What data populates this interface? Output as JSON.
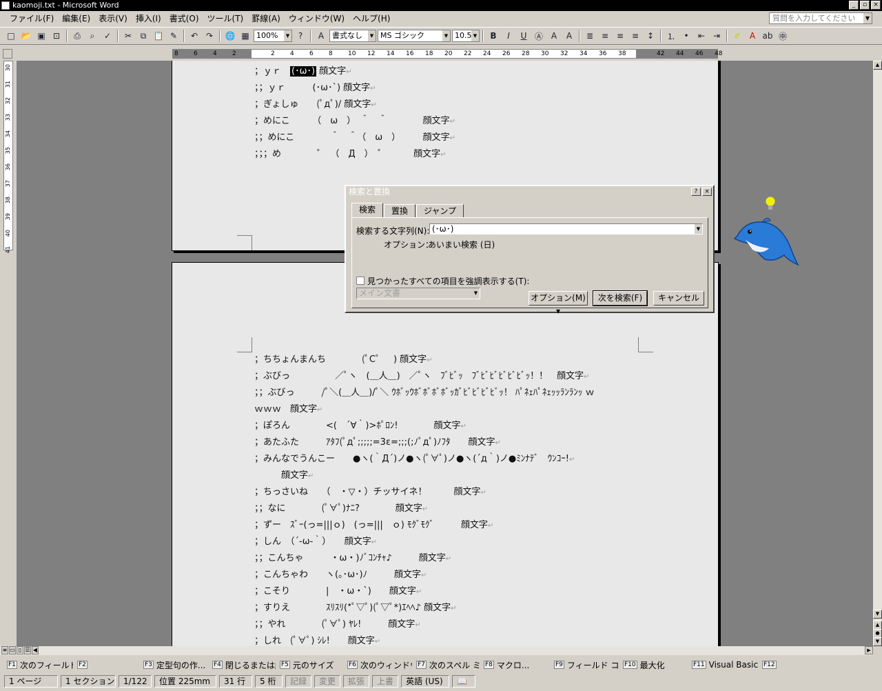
{
  "window": {
    "title": "kaomoji.txt - Microsoft Word"
  },
  "menu": [
    "ファイル(F)",
    "編集(E)",
    "表示(V)",
    "挿入(I)",
    "書式(O)",
    "ツール(T)",
    "罫線(A)",
    "ウィンドウ(W)",
    "ヘルプ(H)"
  ],
  "help_box": {
    "placeholder": "質問を入力してください"
  },
  "toolbar": {
    "zoom": "100%",
    "style": "書式なし",
    "font": "MS ゴシック",
    "size": "10.5"
  },
  "ruler": {
    "marks": [
      "8",
      "6",
      "4",
      "2",
      "2",
      "4",
      "6",
      "8",
      "10",
      "12",
      "14",
      "16",
      "18",
      "20",
      "22",
      "24",
      "26",
      "28",
      "30",
      "32",
      "34",
      "36",
      "38",
      "42",
      "44",
      "46",
      "48"
    ]
  },
  "vruler": {
    "marks": [
      "30",
      "31",
      "32",
      "33",
      "34",
      "35",
      "36",
      "37",
      "38",
      "39",
      "40",
      "41"
    ]
  },
  "page1_lines": [
    {
      "pre": "；ｙｒ　",
      "hl": "(･ω･)",
      "post": " 顔文字"
    },
    {
      "pre": "；；ｙｒ　　　(･ω･`) 顔文字",
      "hl": "",
      "post": ""
    },
    {
      "pre": "；ぎょしゅ　　(ﾟдﾟ)/ 顔文字",
      "hl": "",
      "post": ""
    },
    {
      "pre": "；めにこ　　　（　ω　）　＾　＾　　　　顔文字",
      "hl": "",
      "post": ""
    },
    {
      "pre": "；；めにこ　　　　＾　＾（　ω　）　　　顔文字",
      "hl": "",
      "post": ""
    },
    {
      "pre": "；；；め　　　　゜　（　Д　）　゜　　　顔文字",
      "hl": "",
      "post": ""
    }
  ],
  "page2_lines": [
    "；ちちょんまんち　　　　(ﾟC゜　) 顔文字",
    "；ぶびっ　　　　　／ﾟヽ　(＿人＿)　／ﾟヽ　ﾌﾞﾋﾞｯ　ﾌﾞﾋﾞﾋﾞﾋﾞﾋﾞﾋﾞｯ！！　顔文字",
    "；；ぶびっ　　　/ﾟ＼(＿人＿)/ﾟ＼ ｳﾎﾞｯｳﾎﾞﾎﾞﾎﾞﾎﾞｯｶﾞﾋﾞﾋﾞﾋﾞﾋﾞｯ！ ﾊﾟﾈｪﾊﾟﾈｪｯｯﾗﾝﾗﾝｯ ｗ",
    "ｗｗｗ　顔文字",
    "；ぽろん　　　　<(　´∀｀)>ﾎﾟﾛﾝ!　　　　顔文字",
    "；あたふた　　　ｱﾀﾌ(ﾟдﾟ;;;;;=3ε=;;;(;ﾉﾟдﾟ)ﾉﾌﾀ　　顔文字",
    "；みんなでうんこー　　●ヽ(｀Д´)ノ●ヽ(ﾟ∀ﾟ)ノ●ヽ(´д｀)ノ●ﾐﾝﾅﾃﾞ　ｳﾝｺｰ!",
    "　　　顔文字",
    "；ちっさいね　　（　・▽・）チッサイネ！　　　顔文字",
    "；；なに　　　　(ﾟ∀ﾟ)ﾅﾆ?　　　　顔文字",
    "；ずー　ｽﾞｰ(っ=|||ｏ)　(っ=|||　ｏ) ﾓｸﾞﾓｸﾞ　　　顔文字",
    "；しん　（´-ω-｀）　　顔文字",
    "；；こんちゃ　　　・ω・)ﾉﾞｺﾝﾁｬ♪　　　顔文字",
    "；こんちゃわ　　ヽ(｡･ω･)ﾉ　　　顔文字",
    "；こそり　　　　|　・ω・`)　　顔文字",
    "；すりえ　　　　ｽﾘｽﾘ(*ﾟ▽ﾟ)(ﾟ▽ﾟ*)ｴﾍﾍ♪ 顔文字",
    "；；やれ　　　　(ﾟ∀ﾟ) ﾔﾚ!　　　顔文字",
    "；しれ　(ﾟ∀ﾟ) ｼﾚ!　　顔文字"
  ],
  "paragraph_mark": "↵",
  "dialog": {
    "title": "検索と置換",
    "tabs": [
      "検索",
      "置換",
      "ジャンプ"
    ],
    "find_label": "検索する文字列(N):",
    "find_value": "(･ω･)",
    "options_label": "オプション：",
    "options_value": "あいまい検索 (日)",
    "highlight_label": "見つかったすべての項目を強調表示する(T):",
    "scope_value": "メイン文書",
    "btn_options": "オプション(M) ▾",
    "btn_find_next": "次を検索(F)",
    "btn_cancel": "キャンセル"
  },
  "fkeys": [
    {
      "k": "F1",
      "label": "次のフィールド"
    },
    {
      "k": "F2",
      "label": ""
    },
    {
      "k": "F3",
      "label": "定型句の作..."
    },
    {
      "k": "F4",
      "label": "閉じるまたは終"
    },
    {
      "k": "F5",
      "label": "元のサイズ"
    },
    {
      "k": "F6",
      "label": "次のウィンドウ"
    },
    {
      "k": "F7",
      "label": "次のスペル ミス"
    },
    {
      "k": "F8",
      "label": "マクロ..."
    },
    {
      "k": "F9",
      "label": "フィールド コー..."
    },
    {
      "k": "F10",
      "label": "最大化"
    },
    {
      "k": "F11",
      "label": "Visual Basic..."
    },
    {
      "k": "F12",
      "label": ""
    }
  ],
  "status": {
    "page": "1 ページ",
    "section": "1 セクション",
    "pos": "1/122",
    "location": "位置 225mm",
    "line": "31 行",
    "col": "5 桁",
    "rec": "記録",
    "trk": "変更",
    "ext": "拡張",
    "ovr": "上書",
    "lang": "英語 (US)"
  }
}
